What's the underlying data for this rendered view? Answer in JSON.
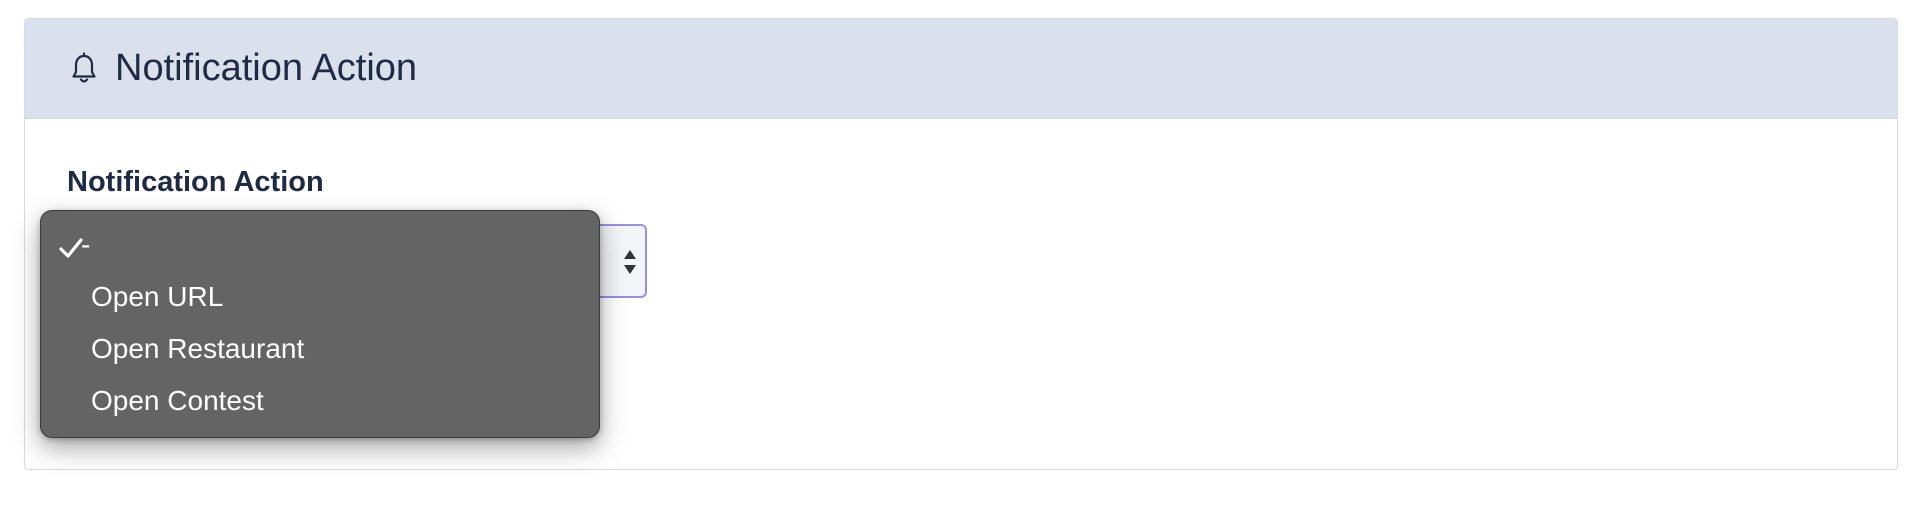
{
  "card": {
    "title": "Notification Action",
    "header_icon": "bell-icon"
  },
  "field": {
    "label": "Notification Action",
    "selected_value": "-"
  },
  "dropdown": {
    "options": [
      {
        "label": "-",
        "selected": true
      },
      {
        "label": "Open URL",
        "selected": false
      },
      {
        "label": "Open Restaurant",
        "selected": false
      },
      {
        "label": "Open Contest",
        "selected": false
      }
    ]
  },
  "colors": {
    "header_bg": "#dbe1ec",
    "title_text": "#1f2a44",
    "select_focus_border": "#9b8cf0",
    "dropdown_bg": "#646464",
    "option_text": "#ffffff"
  }
}
